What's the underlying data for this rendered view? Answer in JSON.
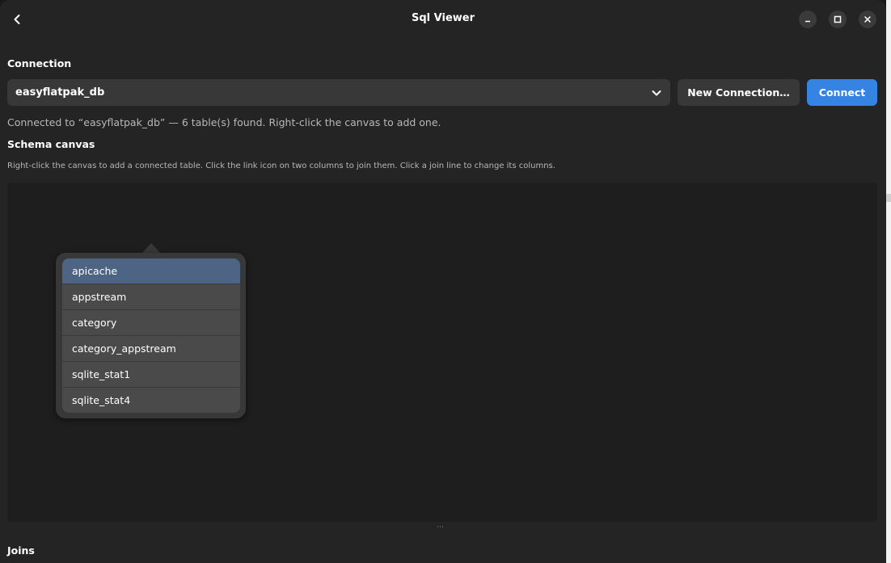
{
  "window": {
    "title": "Sql Viewer",
    "accent_color": "#3584e4"
  },
  "connection": {
    "section_label": "Connection",
    "selected_db": "easyflatpak_db",
    "new_connection_label": "New Connection…",
    "connect_label": "Connect",
    "status_text": "Connected to “easyflatpak_db” — 6 table(s) found. Right-click the canvas to add one."
  },
  "schema": {
    "section_label": "Schema canvas",
    "hint": "Right-click the canvas to add a connected table. Click the link icon on two columns to join them. Click a join line to change its columns.",
    "resize_handle": "⋯"
  },
  "table_menu": {
    "selected_index": 0,
    "items": [
      {
        "label": "apicache"
      },
      {
        "label": "appstream"
      },
      {
        "label": "category"
      },
      {
        "label": "category_appstream"
      },
      {
        "label": "sqlite_stat1"
      },
      {
        "label": "sqlite_stat4"
      }
    ]
  },
  "joins": {
    "section_label": "Joins"
  }
}
